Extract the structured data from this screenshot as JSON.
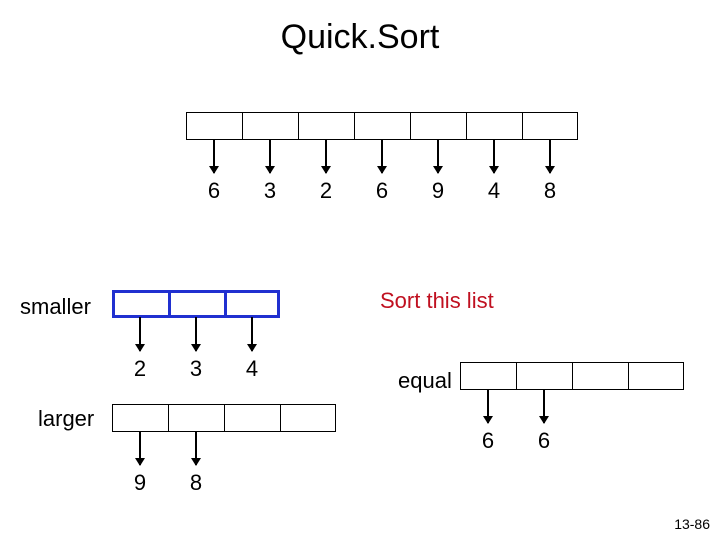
{
  "title": "Quick.Sort",
  "top_row": {
    "count": 7,
    "values": [
      "6",
      "3",
      "2",
      "6",
      "9",
      "4",
      "8"
    ]
  },
  "smaller": {
    "label": "smaller",
    "count": 3,
    "values": [
      "2",
      "3",
      "4"
    ]
  },
  "sort_label": "Sort this list",
  "larger": {
    "label": "larger",
    "count": 4,
    "values": [
      "9",
      "8"
    ]
  },
  "equal": {
    "label": "equal",
    "count": 4,
    "values": [
      "6",
      "6"
    ]
  },
  "page": "13-86",
  "chart_data": {
    "type": "table",
    "title": "Quick.Sort partition step",
    "input": [
      6,
      3,
      2,
      6,
      9,
      4,
      8
    ],
    "smaller": [
      2,
      3,
      4
    ],
    "equal": [
      6,
      6
    ],
    "larger": [
      9,
      8
    ],
    "annotation": "Sort this list (smaller partition highlighted)"
  }
}
